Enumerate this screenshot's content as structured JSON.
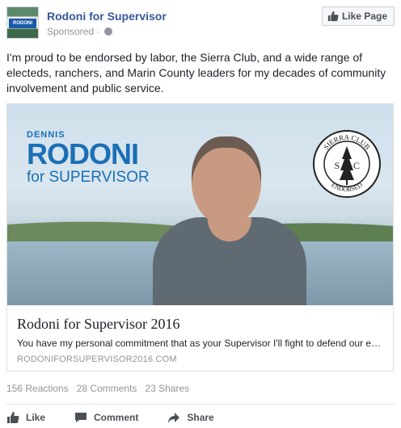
{
  "header": {
    "page_name": "Rodoni for Supervisor",
    "sponsored": "Sponsored ·",
    "avatar_text": "RODONI",
    "like_page_label": "Like Page"
  },
  "post": {
    "text": "I'm proud to be endorsed by labor, the Sierra Club, and a wide range of electeds, ranchers, and Marin County leaders for my decades of community involvement and public service."
  },
  "attachment": {
    "logo_first": "DENNIS",
    "logo_last": "RODONI",
    "logo_office": "for SUPERVISOR",
    "seal_top": "SIERRA CLUB",
    "seal_bottom": "ENDORSED",
    "seal_left": "S",
    "seal_right": "C",
    "title": "Rodoni for Supervisor 2016",
    "description": "You have my personal commitment that as your Supervisor I'll fight to defend our e…",
    "domain": "RODONIFORSUPERVISOR2016.COM"
  },
  "stats": {
    "reactions": "156 Reactions",
    "comments": "28 Comments",
    "shares": "23 Shares"
  },
  "actions": {
    "like": "Like",
    "comment": "Comment",
    "share": "Share"
  },
  "colors": {
    "link_blue": "#365899",
    "logo_blue": "#1b6fb5",
    "muted_text": "#90949c"
  }
}
